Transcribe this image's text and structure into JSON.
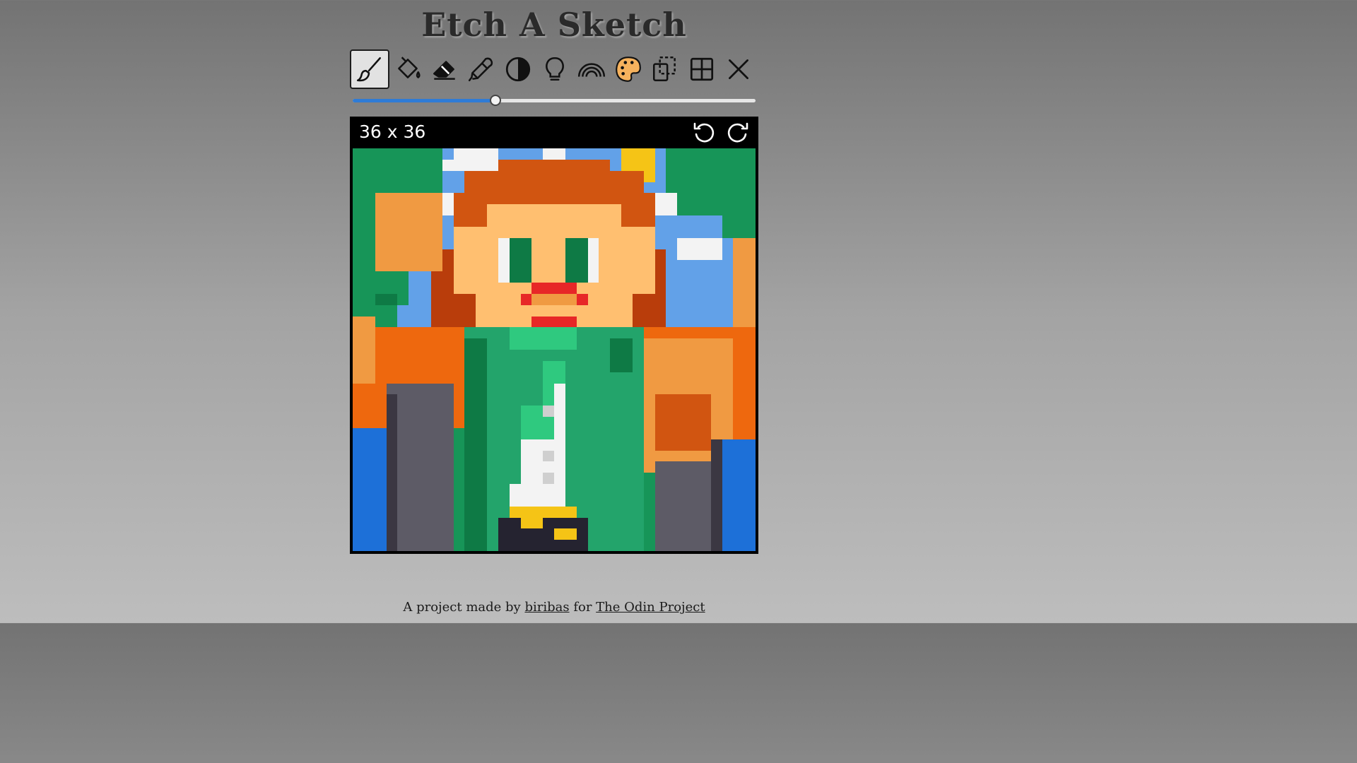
{
  "app": {
    "title": "Etch A Sketch"
  },
  "toolbar": {
    "active_tool": "brush",
    "tools": [
      "brush-icon",
      "fill-bucket-icon",
      "eraser-icon",
      "eyedropper-icon",
      "contrast-icon",
      "lightbulb-icon",
      "rainbow-icon",
      "palette-icon",
      "copy-selection-icon",
      "grid-icon",
      "close-icon"
    ]
  },
  "slider": {
    "value": 36,
    "min": 1,
    "max": 100
  },
  "board": {
    "size_label": "36 x 36"
  },
  "footer": {
    "prefix": "A project made by",
    "author": "biribas",
    "middle": "for",
    "project": "The Odin Project"
  },
  "colors": {
    "background": "#bcbcbc",
    "brush_accent": "#2e7bd6",
    "palette_color": "#f6b25d",
    "grid_colors": {
      "forest_green": "#179558",
      "dark_green": "#0e7a45",
      "sky_blue": "#62a1e8",
      "white": "#f3f3f3",
      "hair_orange": "#d15511",
      "hair_dark": "#b93d0b",
      "skin": "#ffbf70",
      "jacket_orange": "#ee680e",
      "light_orange": "#f09a42",
      "gray": "#5d5b66",
      "royal_blue": "#1d70d8",
      "emerald": "#23a46b",
      "bright_green": "#2fc97f",
      "lip_red": "#e72727",
      "gold": "#f5c416",
      "near_black": "#252330"
    }
  }
}
